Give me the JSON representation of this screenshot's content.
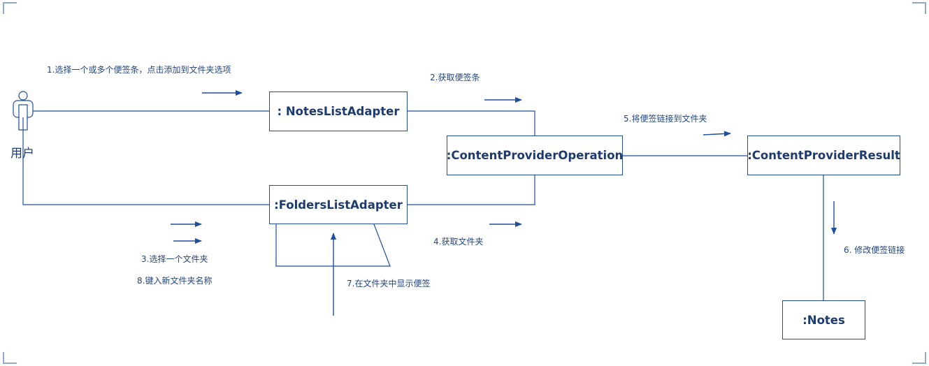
{
  "diagram": {
    "actor": {
      "label": "用户"
    },
    "objects": {
      "notes_list_adapter": ": NotesListAdapter",
      "content_provider_operation": ":ContentProviderOperation",
      "folders_list_adapter": ":FoldersListAdapter",
      "content_provider_result": ":ContentProviderResult",
      "notes": ":Notes"
    },
    "messages": {
      "m1": "1.选择一个或多个便签条，点击添加到文件夹选项",
      "m2": "2.获取便签条",
      "m3": "3.选择一个文件夹",
      "m4": "4.获取文件夹",
      "m5": "5.将便签链接到文件夹",
      "m6": "6. 修改便签链接",
      "m7": "7.在文件夹中显示便签",
      "m8": "8.键入新文件夹名称"
    },
    "colors": {
      "line": "#1F4E9A",
      "text": "#1E3B6E",
      "corner_marks": "#8FA9C8"
    }
  }
}
